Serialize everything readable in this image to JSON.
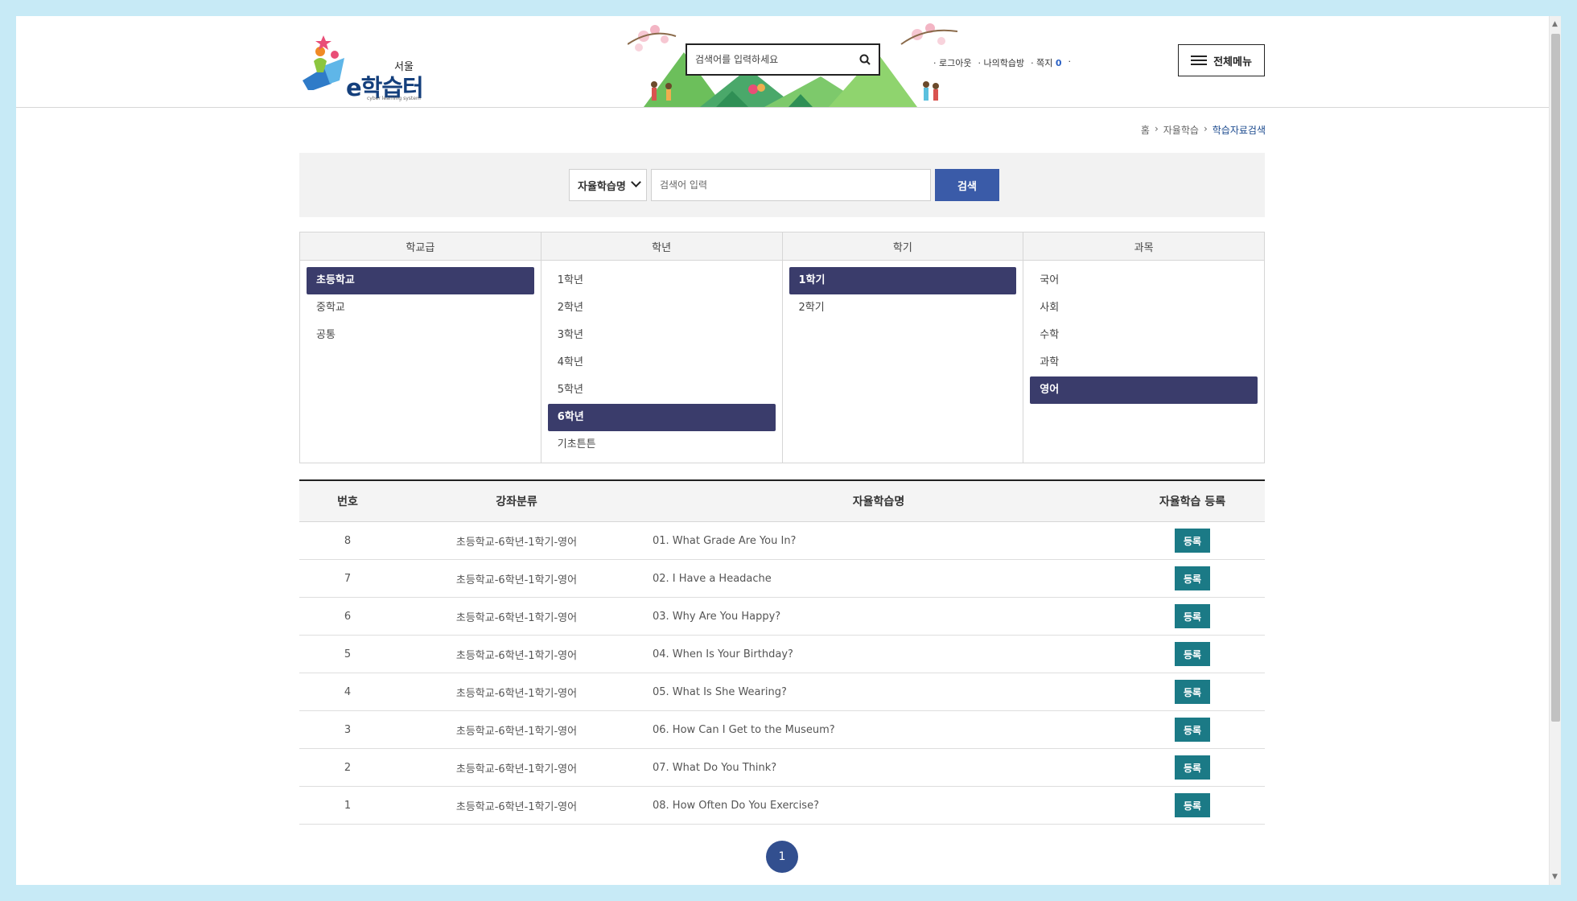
{
  "header": {
    "logo": {
      "region": "서울",
      "name": "e학습터",
      "tagline": "cyber learning system"
    },
    "search": {
      "placeholder": "검색어를 입력하세요"
    },
    "links": {
      "logout": "로그아웃",
      "my_room": "나의학습방",
      "messages_label": "쪽지",
      "messages_count": "0"
    },
    "menu_label": "전체메뉴"
  },
  "breadcrumb": {
    "items": [
      "홈",
      "자율학습",
      "학습자료검색"
    ]
  },
  "search_bar": {
    "select_value": "자율학습명",
    "input_placeholder": "검색어 입력",
    "button_label": "검색"
  },
  "filters": {
    "columns": [
      {
        "title": "학교급",
        "items": [
          "초등학교",
          "중학교",
          "공통"
        ],
        "selected": 0
      },
      {
        "title": "학년",
        "items": [
          "1학년",
          "2학년",
          "3학년",
          "4학년",
          "5학년",
          "6학년",
          "기초튼튼"
        ],
        "selected": 5
      },
      {
        "title": "학기",
        "items": [
          "1학기",
          "2학기"
        ],
        "selected": 0
      },
      {
        "title": "과목",
        "items": [
          "국어",
          "사회",
          "수학",
          "과학",
          "영어"
        ],
        "selected": 4
      }
    ]
  },
  "table": {
    "headers": [
      "번호",
      "강좌분류",
      "자율학습명",
      "자율학습 등록"
    ],
    "register_label": "등록",
    "rows": [
      {
        "no": "8",
        "category": "초등학교-6학년-1학기-영어",
        "title": "01. What Grade Are You In?"
      },
      {
        "no": "7",
        "category": "초등학교-6학년-1학기-영어",
        "title": "02. I Have a Headache"
      },
      {
        "no": "6",
        "category": "초등학교-6학년-1학기-영어",
        "title": "03. Why Are You Happy?"
      },
      {
        "no": "5",
        "category": "초등학교-6학년-1학기-영어",
        "title": "04. When Is Your Birthday?"
      },
      {
        "no": "4",
        "category": "초등학교-6학년-1학기-영어",
        "title": "05. What Is She Wearing?"
      },
      {
        "no": "3",
        "category": "초등학교-6학년-1학기-영어",
        "title": "06. How Can I Get to the Museum?"
      },
      {
        "no": "2",
        "category": "초등학교-6학년-1학기-영어",
        "title": "07. What Do You Think?"
      },
      {
        "no": "1",
        "category": "초등학교-6학년-1학기-영어",
        "title": "08. How Often Do You Exercise?"
      }
    ]
  },
  "pagination": {
    "current": "1"
  },
  "colors": {
    "selected_bg": "#3a3c6b",
    "search_button": "#3a5ba8",
    "register_button": "#1b7a86",
    "page_bg": "#c7eaf6"
  }
}
